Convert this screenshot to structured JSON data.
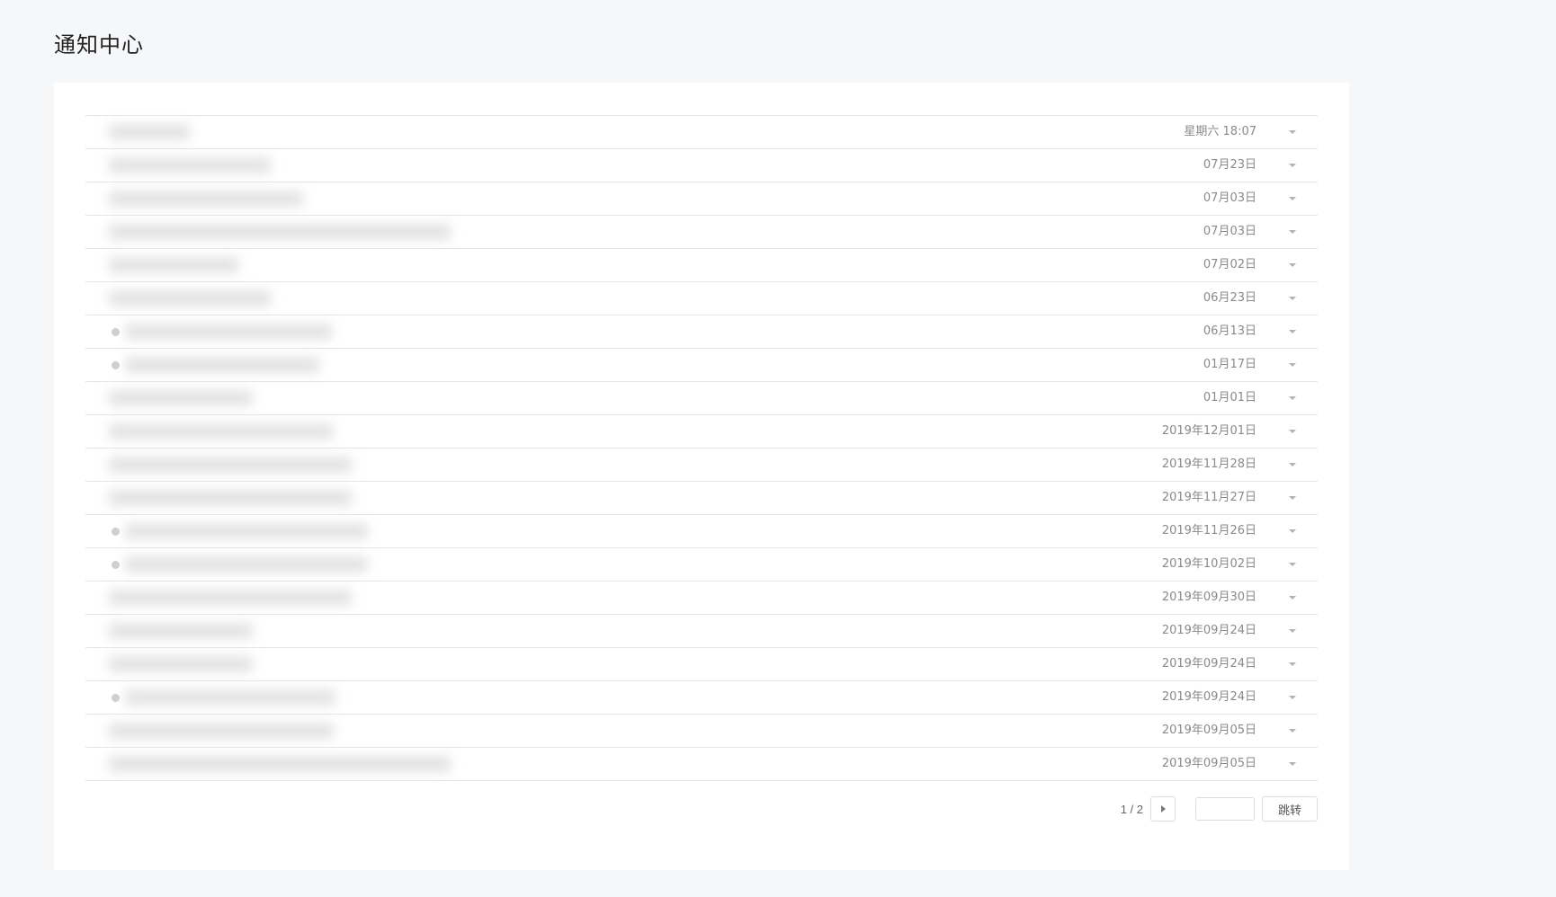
{
  "page": {
    "title": "通知中心"
  },
  "notifications": [
    {
      "date": "星期六 18:07",
      "unread": false
    },
    {
      "date": "07月23日",
      "unread": false
    },
    {
      "date": "07月03日",
      "unread": false
    },
    {
      "date": "07月03日",
      "unread": false
    },
    {
      "date": "07月02日",
      "unread": false
    },
    {
      "date": "06月23日",
      "unread": false
    },
    {
      "date": "06月13日",
      "unread": true
    },
    {
      "date": "01月17日",
      "unread": true
    },
    {
      "date": "01月01日",
      "unread": false
    },
    {
      "date": "2019年12月01日",
      "unread": false
    },
    {
      "date": "2019年11月28日",
      "unread": false
    },
    {
      "date": "2019年11月27日",
      "unread": false
    },
    {
      "date": "2019年11月26日",
      "unread": true
    },
    {
      "date": "2019年10月02日",
      "unread": true
    },
    {
      "date": "2019年09月30日",
      "unread": false
    },
    {
      "date": "2019年09月24日",
      "unread": false
    },
    {
      "date": "2019年09月24日",
      "unread": false
    },
    {
      "date": "2019年09月24日",
      "unread": true
    },
    {
      "date": "2019年09月05日",
      "unread": false
    },
    {
      "date": "2019年09月05日",
      "unread": false
    }
  ],
  "pagination": {
    "page_info": "1 / 2",
    "jump_input_value": "",
    "jump_label": "跳转"
  },
  "icons": {
    "row_toggle": "chevron-down-icon",
    "next_page": "caret-right-icon"
  }
}
